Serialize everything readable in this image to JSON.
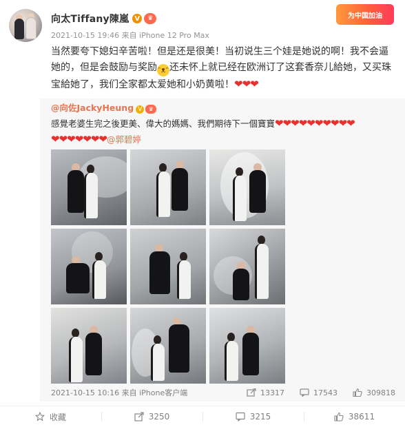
{
  "post": {
    "author": "向太Tiffany陳嵐",
    "verified_badge": "V",
    "member_badge": "♛",
    "timestamp": "2021-10-15 19:46",
    "source": "来自 iPhone 12 Pro Max",
    "event_badge": "为中国加油",
    "text_part1": "当然要夸下媳妇辛苦啦！但是还是很美！当初说生三个娃是她说的啊！我不会逼她的，但是会鼓励与奖励",
    "emoji": "ᵔᴥᵔ",
    "text_part2": "还未怀上就已经在欧洲订了这套香奈儿給她，又买珠宝給她了，我们全家都太爱她和小奶黄啦！",
    "hearts": "❤❤❤"
  },
  "repost": {
    "author": "@向佐JackyHeung",
    "verified_badge": "V",
    "member_badge": "♛",
    "text": "感覺老婆生完之後更美、偉大的媽媽、我們期待下一個寶寶",
    "hearts_line1": "❤❤❤❤❤❤❤❤❤❤",
    "hearts_line2": "❤❤❤❤❤❤❤",
    "mention": "@郭碧婷",
    "timestamp": "2021-10-15 10:16",
    "source": "来自 iPhone客户端",
    "reposts": "13317",
    "comments": "17543",
    "likes": "309818"
  },
  "actions": {
    "favorite_label": "收藏",
    "repost_count": "3250",
    "comment_count": "3215",
    "like_count": "38611"
  },
  "icons": {
    "favorite": "star-icon",
    "repost": "share-icon",
    "comment": "comment-icon",
    "like": "thumbs-up-icon"
  },
  "colors": {
    "accent": "#eb7350",
    "heart": "#e8302f",
    "verified": "#f29100",
    "muted": "#939393"
  }
}
